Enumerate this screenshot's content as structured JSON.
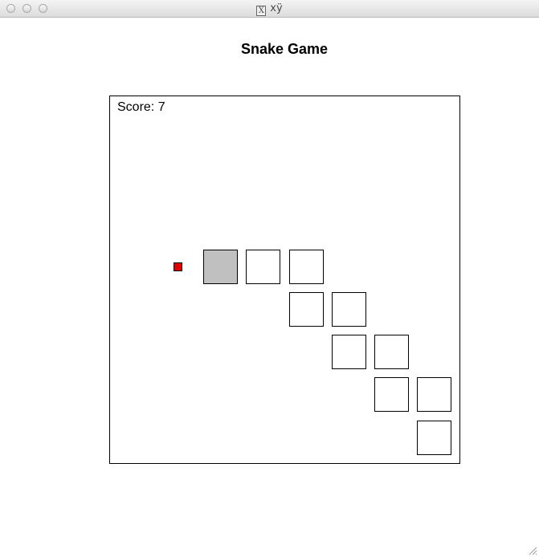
{
  "window": {
    "title": "xÿ",
    "app_icon": "x11-icon"
  },
  "game": {
    "title": "Snake Game",
    "score_label": "Score: 7",
    "score": 7,
    "head_color": "#c0c0c0",
    "body_color": "#ffffff",
    "food_color": "#e00000"
  }
}
